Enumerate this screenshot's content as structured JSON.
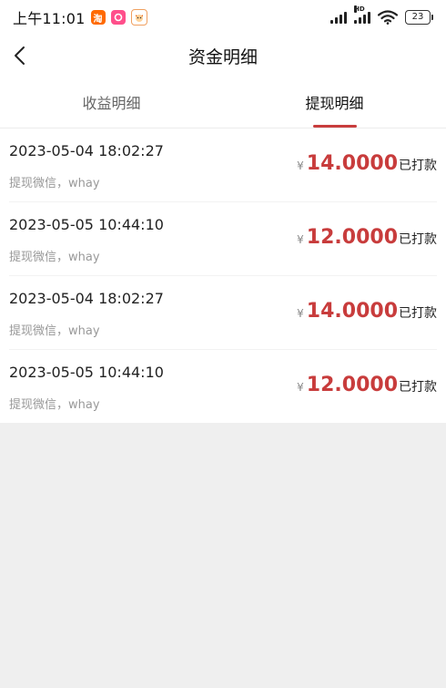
{
  "status_bar": {
    "time": "上午11:01",
    "battery": "23",
    "network_label": "HD"
  },
  "header": {
    "title": "资金明细"
  },
  "tabs": [
    {
      "label": "收益明细",
      "active": false
    },
    {
      "label": "提现明细",
      "active": true
    }
  ],
  "records": [
    {
      "time": "2023-05-04 18:02:27",
      "desc": "提现微信，whay",
      "currency": "¥",
      "amount": "14.0000",
      "status": "已打款"
    },
    {
      "time": "2023-05-05 10:44:10",
      "desc": "提现微信，whay",
      "currency": "¥",
      "amount": "12.0000",
      "status": "已打款"
    },
    {
      "time": "2023-05-04 18:02:27",
      "desc": "提现微信，whay",
      "currency": "¥",
      "amount": "14.0000",
      "status": "已打款"
    },
    {
      "time": "2023-05-05 10:44:10",
      "desc": "提现微信，whay",
      "currency": "¥",
      "amount": "12.0000",
      "status": "已打款"
    }
  ],
  "colors": {
    "accent": "#c83c3c",
    "background": "#efefef"
  },
  "icons": {
    "back": "chevron-left-icon",
    "wifi": "wifi-icon",
    "signal": "signal-icon",
    "battery": "battery-icon"
  }
}
